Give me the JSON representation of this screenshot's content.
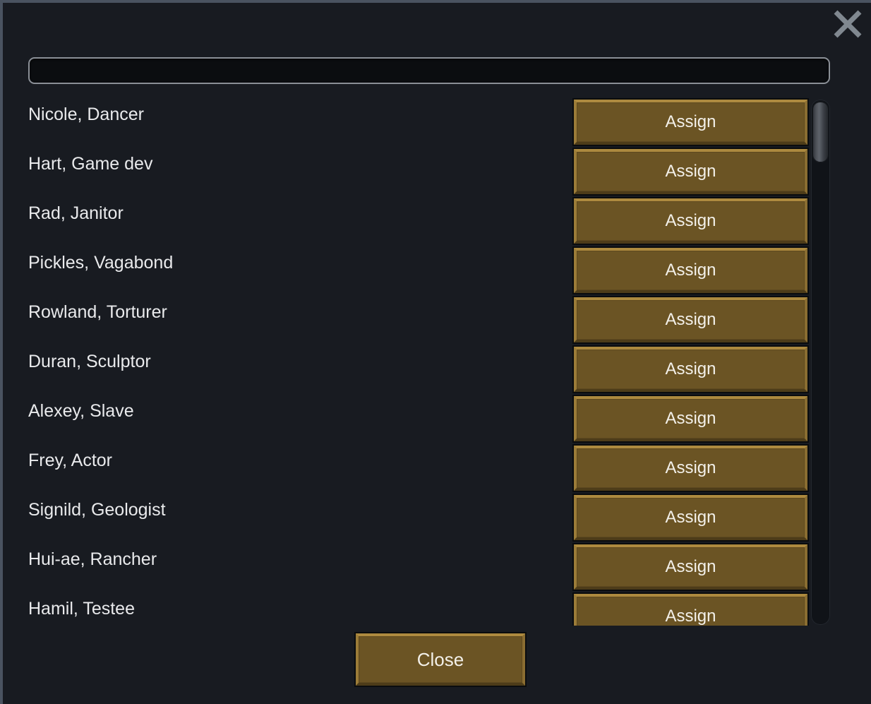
{
  "dialog": {
    "background_color": "#181b21",
    "border_color": "#4a5360"
  },
  "close_icon": {
    "name": "close-icon",
    "glyph": "×",
    "color": "#808890"
  },
  "search": {
    "value": "",
    "placeholder": ""
  },
  "list": {
    "assign_label": "Assign",
    "rows": [
      {
        "name": "Nicole, Dancer",
        "action": "Assign"
      },
      {
        "name": "Hart, Game dev",
        "action": "Assign"
      },
      {
        "name": "Rad, Janitor",
        "action": "Assign"
      },
      {
        "name": "Pickles, Vagabond",
        "action": "Assign"
      },
      {
        "name": "Rowland, Torturer",
        "action": "Assign"
      },
      {
        "name": "Duran, Sculptor",
        "action": "Assign"
      },
      {
        "name": "Alexey, Slave",
        "action": "Assign"
      },
      {
        "name": "Frey, Actor",
        "action": "Assign"
      },
      {
        "name": "Signild, Geologist",
        "action": "Assign"
      },
      {
        "name": "Hui-ae, Rancher",
        "action": "Assign"
      },
      {
        "name": "Hamil, Testee",
        "action": "Assign"
      }
    ]
  },
  "scrollbar": {
    "orientation": "vertical",
    "thumb_position_percent": 0
  },
  "footer": {
    "close_label": "Close"
  },
  "colors": {
    "button_face": "#6b5424",
    "button_bevel_light": "#ad8a3f",
    "button_bevel_dark": "#4d3c19",
    "button_text": "#f3f0e9",
    "list_text": "#e9eaec",
    "panel_background": "#181b21",
    "input_background": "#0b0d10",
    "input_border": "#8a8f96"
  }
}
